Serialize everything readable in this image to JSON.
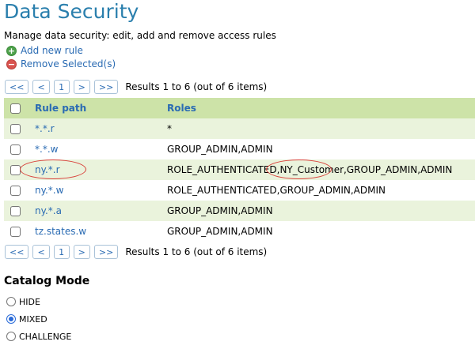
{
  "page": {
    "title": "Data Security",
    "description": "Manage data security: edit, add and remove access rules",
    "add_label": "Add new rule",
    "remove_label": "Remove Selected(s)"
  },
  "pager": {
    "first": "<<",
    "prev": "<",
    "page": "1",
    "next": ">",
    "last": ">>",
    "results": "Results 1 to 6 (out of 6 items)"
  },
  "table": {
    "headers": {
      "path": "Rule path",
      "roles": "Roles"
    },
    "rows": [
      {
        "path": "*.*.r",
        "roles": "*"
      },
      {
        "path": "*.*.w",
        "roles": "GROUP_ADMIN,ADMIN"
      },
      {
        "path": "ny.*.r",
        "roles": "ROLE_AUTHENTICATED,NY_Customer,GROUP_ADMIN,ADMIN"
      },
      {
        "path": "ny.*.w",
        "roles": "ROLE_AUTHENTICATED,GROUP_ADMIN,ADMIN"
      },
      {
        "path": "ny.*.a",
        "roles": "GROUP_ADMIN,ADMIN"
      },
      {
        "path": "tz.states.w",
        "roles": "GROUP_ADMIN,ADMIN"
      }
    ]
  },
  "catalog": {
    "heading": "Catalog Mode",
    "options": [
      "HIDE",
      "MIXED",
      "CHALLENGE"
    ],
    "selected": "MIXED"
  },
  "colors": {
    "title": "#2a7fad",
    "link": "#2a6bb3",
    "header_bg": "#cde3a8",
    "alt_row_bg": "#eaf3dc",
    "annotation": "#d9413a"
  }
}
